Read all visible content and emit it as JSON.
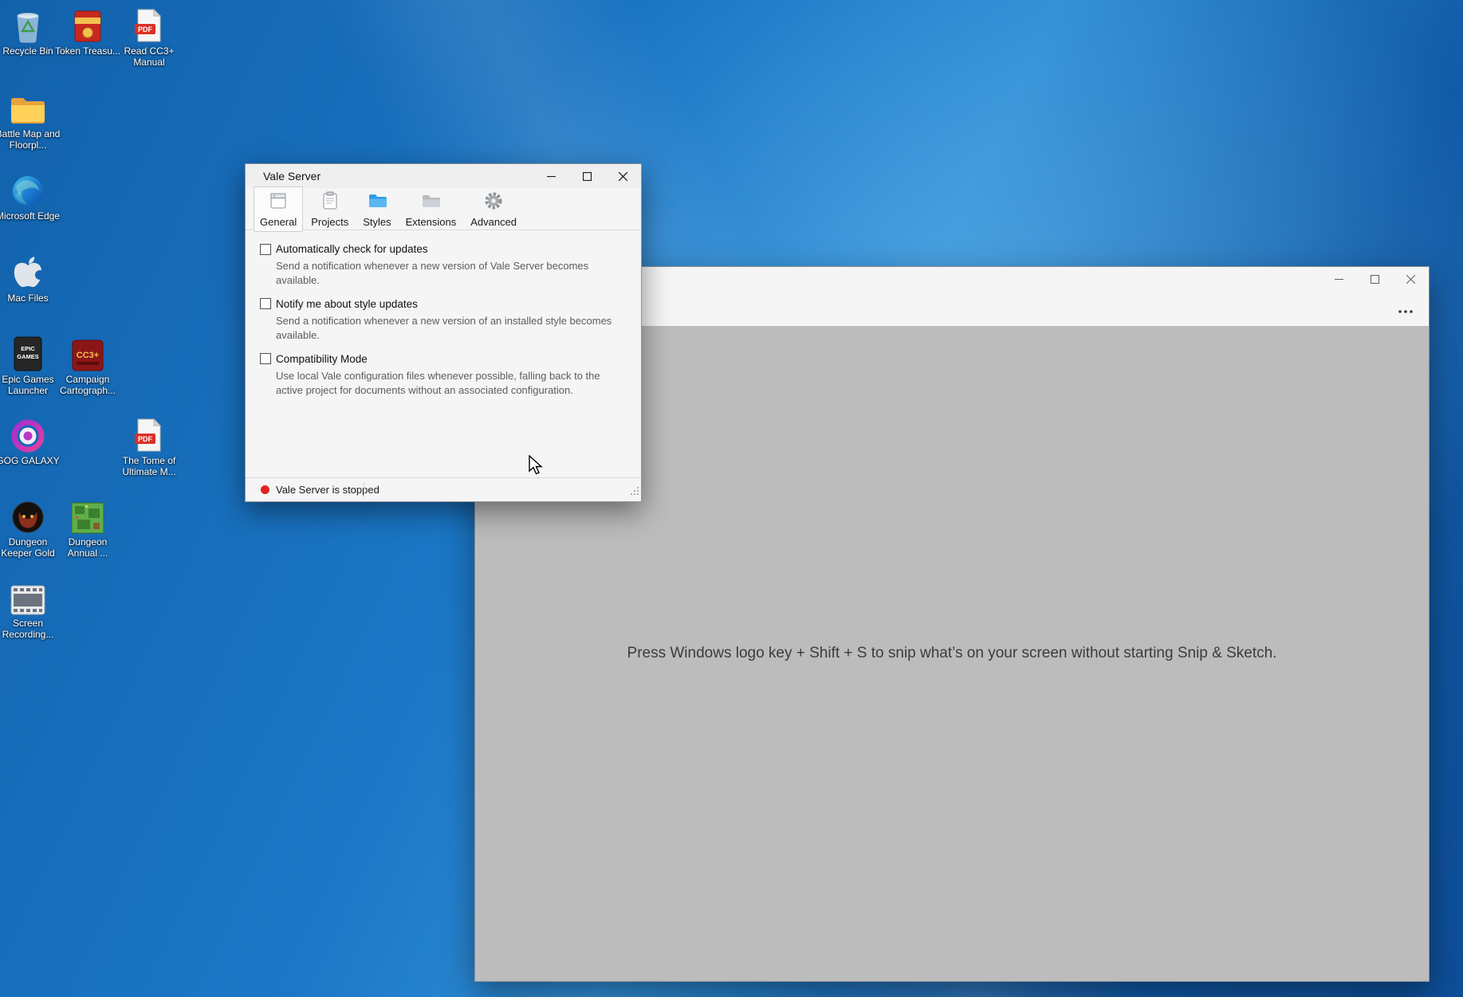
{
  "desktop": {
    "icons": [
      {
        "label": "Recycle Bin",
        "icon": "recycle-bin-icon"
      },
      {
        "label": "Token Treasu...",
        "icon": "red-chest-icon"
      },
      {
        "label": "Read CC3+ Manual",
        "icon": "pdf-file-icon"
      },
      {
        "label": "Battle Map and Floorpl...",
        "icon": "folder-icon"
      },
      {
        "label": "Microsoft Edge",
        "icon": "edge-browser-icon"
      },
      {
        "label": "Mac Files",
        "icon": "apple-icon"
      },
      {
        "label": "Epic Games Launcher",
        "icon": "epic-games-icon"
      },
      {
        "label": "Campaign Cartograph...",
        "icon": "cc3-app-icon"
      },
      {
        "label": "GOG GALAXY",
        "icon": "gog-galaxy-icon"
      },
      {
        "label": "The Tome of Ultimate M...",
        "icon": "pdf-file-icon"
      },
      {
        "label": "Dungeon Keeper Gold",
        "icon": "dungeon-keeper-icon"
      },
      {
        "label": "Dungeon Annual ...",
        "icon": "pixel-map-icon"
      },
      {
        "label": "Screen Recording...",
        "icon": "film-strip-icon"
      }
    ]
  },
  "vale_window": {
    "title": "Vale Server",
    "toolbar_tabs": [
      {
        "label": "General",
        "icon": "window-pane-icon",
        "selected": true
      },
      {
        "label": "Projects",
        "icon": "clipboard-icon",
        "selected": false
      },
      {
        "label": "Styles",
        "icon": "blue-folder-icon",
        "selected": false
      },
      {
        "label": "Extensions",
        "icon": "gray-folder-icon",
        "selected": false
      },
      {
        "label": "Advanced",
        "icon": "gear-icon",
        "selected": false
      }
    ],
    "settings": [
      {
        "label": "Automatically check for updates",
        "checked": false,
        "description": "Send a notification whenever a new version of Vale Server becomes available."
      },
      {
        "label": "Notify me about style updates",
        "checked": false,
        "description": "Send a notification whenever a new version of an installed style becomes available."
      },
      {
        "label": "Compatibility Mode",
        "checked": false,
        "description": "Use local Vale configuration files whenever possible, falling back to the active project for documents without an associated configuration."
      }
    ],
    "status": {
      "text": "Vale Server is stopped",
      "indicator_color": "#e0241c"
    }
  },
  "snip_window": {
    "message": "Press Windows logo key + Shift + S to snip what’s on your screen without starting Snip & Sketch."
  }
}
